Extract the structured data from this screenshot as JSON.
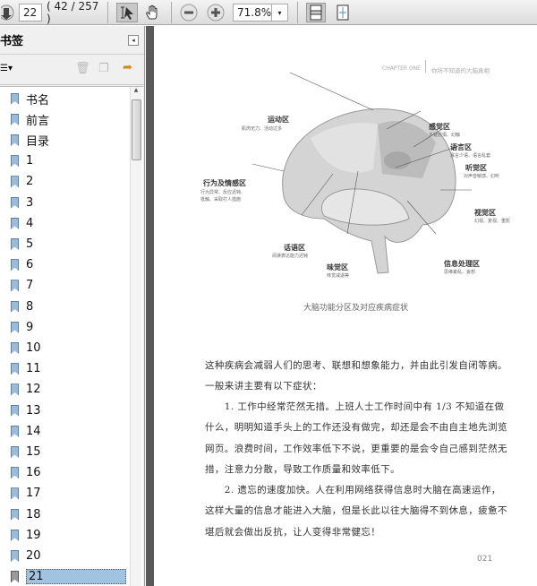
{
  "toolbar": {
    "page_input": "22",
    "page_count": "( 42 / 257 )",
    "zoom": "71.8%"
  },
  "sidebar": {
    "title": "书签",
    "items": [
      "书名",
      "前言",
      "目录",
      "1",
      "2",
      "3",
      "4",
      "5",
      "6",
      "7",
      "8",
      "9",
      "10",
      "11",
      "12",
      "13",
      "14",
      "15",
      "16",
      "17",
      "18",
      "19",
      "20",
      "21"
    ],
    "selected": "21"
  },
  "page": {
    "header_en": "CHAPTER ONE",
    "header_cn": "你所不知道的大脑真相",
    "figure": {
      "caption": "大脑功能分区及对应疾病症状",
      "labels": [
        {
          "title": "运动区",
          "desc": "肌肉无力、活动过多"
        },
        {
          "title": "感觉区",
          "desc": "多疑恐惧、幻触"
        },
        {
          "title": "语言区",
          "desc": "寡言少语、语言乱套"
        },
        {
          "title": "听觉区",
          "desc": "对声音敏感、幻听"
        },
        {
          "title": "行为及情感区",
          "desc": "行为异常、反应迟钝、\n抵触、采取打人措施"
        },
        {
          "title": "视觉区",
          "desc": "幻视、复视、重影"
        },
        {
          "title": "话语区",
          "desc": "阅读表达能力迟钝"
        },
        {
          "title": "味觉区",
          "desc": "味觉减退等"
        },
        {
          "title": "信息处理区",
          "desc": "思维紊乱、妄想"
        }
      ]
    },
    "paragraphs": [
      "这种疾病会减弱人们的思考、联想和想象能力，并由此引发自闭等病。一般来讲主要有以下症状：",
      "　　1. 工作中经常茫然无措。上班人士工作时间中有 1/3 不知道在做什么，明明知道手头上的工作还没有做完，却还是会不由自主地先浏览网页。浪费时间，工作效率低下不说，更重要的是会令自己感到茫然无措，注意力分散，导致工作质量和效率低下。",
      "　　2. 遗忘的速度加快。人在利用网络获得信息时大脑在高速运作，这样大量的信息才能进入大脑，但是长此以往大脑得不到休息，疲惫不堪后就会做出反抗，让人变得非常健忘！"
    ],
    "page_number": "021"
  }
}
